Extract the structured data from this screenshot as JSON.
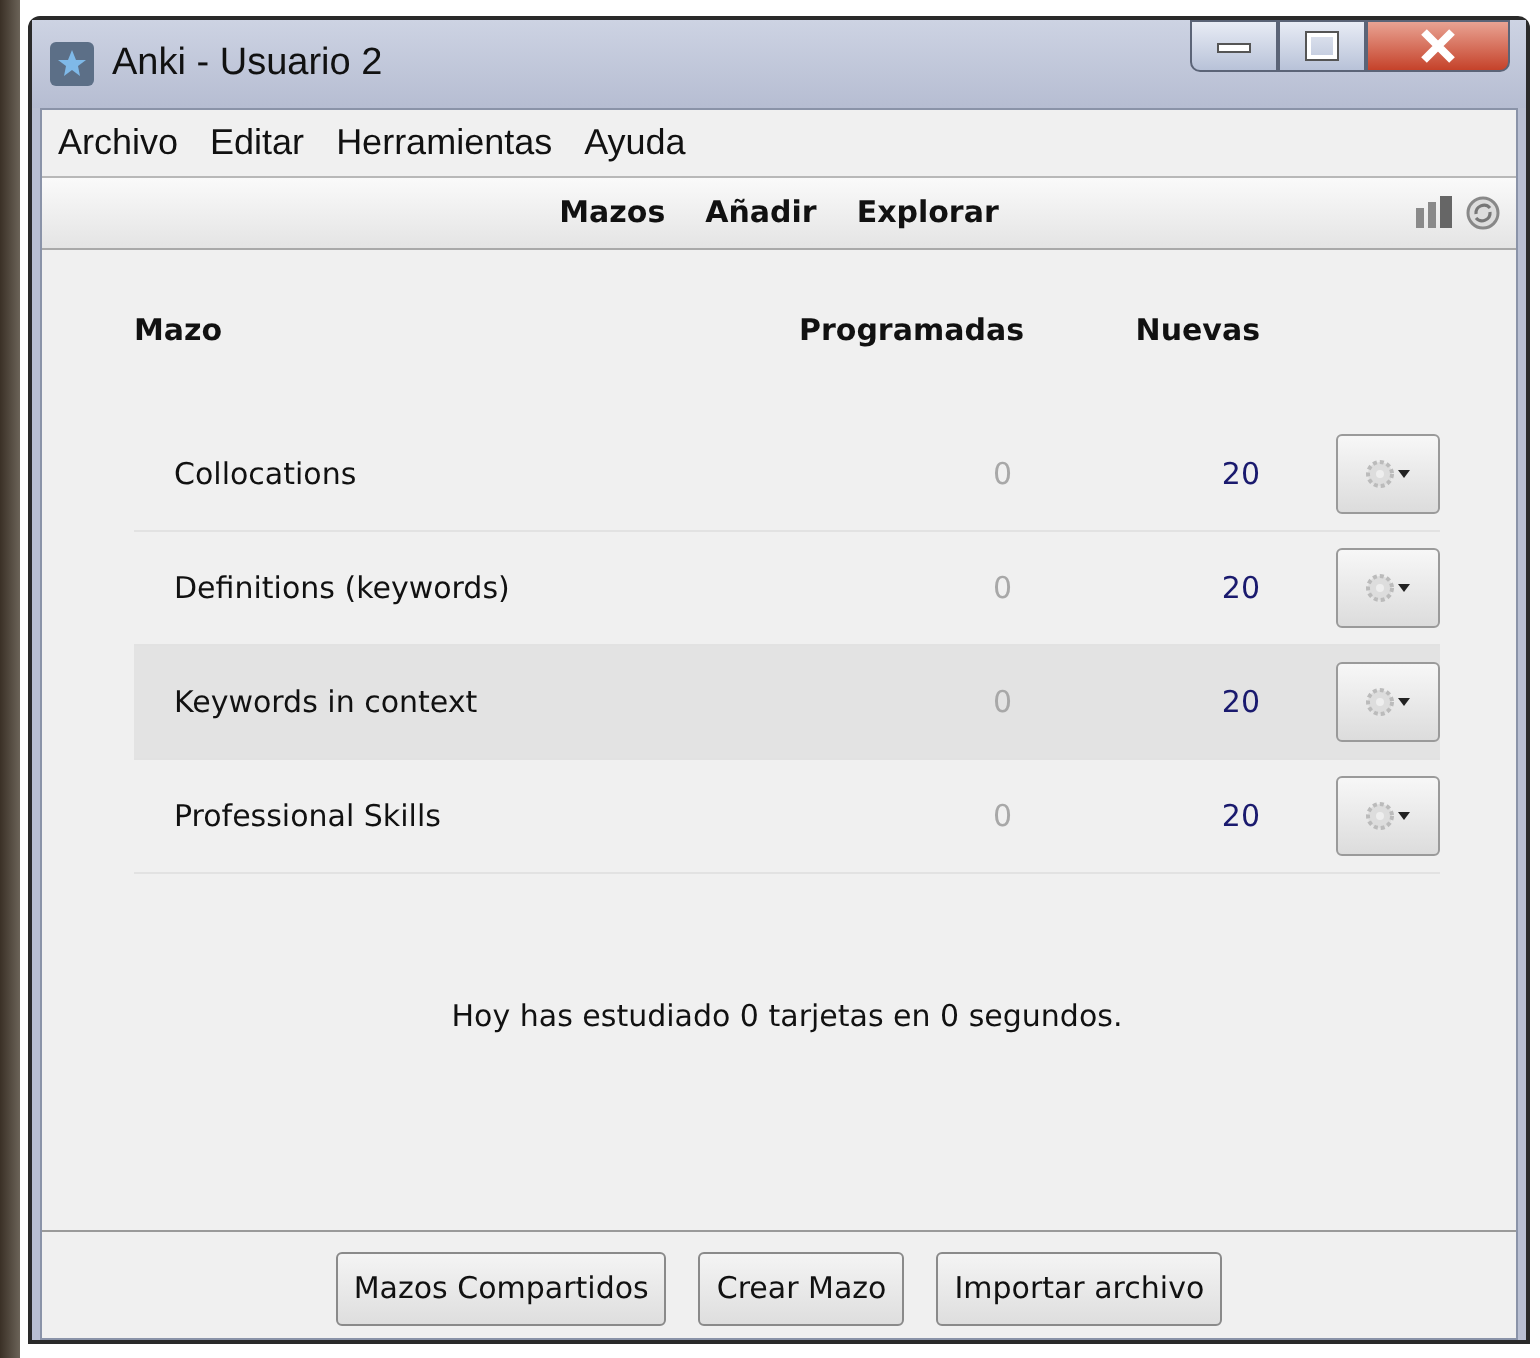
{
  "window": {
    "title": "Anki - Usuario 2"
  },
  "menu": [
    "Archivo",
    "Editar",
    "Herramientas",
    "Ayuda"
  ],
  "toolbar": {
    "links": [
      "Mazos",
      "Añadir",
      "Explorar"
    ]
  },
  "table": {
    "columns": [
      "Mazo",
      "Programadas",
      "Nuevas"
    ],
    "rows": [
      {
        "name": "Collocations",
        "due": "0",
        "new": "20",
        "selected": false
      },
      {
        "name": "Definitions (keywords)",
        "due": "0",
        "new": "20",
        "selected": false
      },
      {
        "name": "Keywords in context",
        "due": "0",
        "new": "20",
        "selected": true
      },
      {
        "name": "Professional Skills",
        "due": "0",
        "new": "20",
        "selected": false
      }
    ]
  },
  "summary": "Hoy has estudiado 0 tarjetas en 0 segundos.",
  "buttons": [
    "Mazos Compartidos",
    "Crear Mazo",
    "Importar archivo"
  ]
}
